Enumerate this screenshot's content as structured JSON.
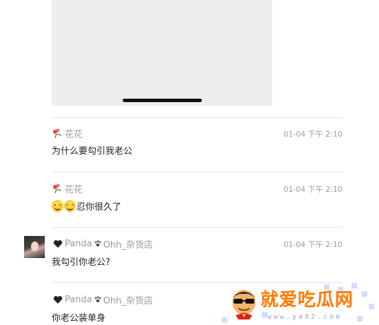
{
  "comments": [
    {
      "author": "花花",
      "author_icon": "flower-icon",
      "time": "01-04 下午 2:10",
      "text": "为什么要勾引我老公"
    },
    {
      "author": "花花",
      "author_icon": "flower-icon",
      "time": "01-04 下午 2:10",
      "emojis": [
        "smile-emoji",
        "smile-emoji"
      ],
      "text": "忍你很久了"
    },
    {
      "author_prefix_icon": "black-heart-icon",
      "author_part1": "Panda",
      "author_mid_icon": "paw-icon",
      "author_part2": "Ohh_杂货店",
      "time": "01-04 下午 2:10",
      "text": "我勾引你老公?",
      "has_avatar": true
    },
    {
      "author_prefix_icon": "black-heart-icon",
      "author_part1": "Panda",
      "author_mid_icon": "paw-icon",
      "author_part2": "Ohh_杂货店",
      "text": "你老公装单身"
    }
  ],
  "watermark": {
    "title": "就爱吃瓜网",
    "url": "www.ya92.com",
    "accent": "#ff7a00"
  },
  "colors": {
    "meta_text": "#9a9a9a",
    "body_text": "#222222",
    "divider": "#e6e6e6"
  }
}
